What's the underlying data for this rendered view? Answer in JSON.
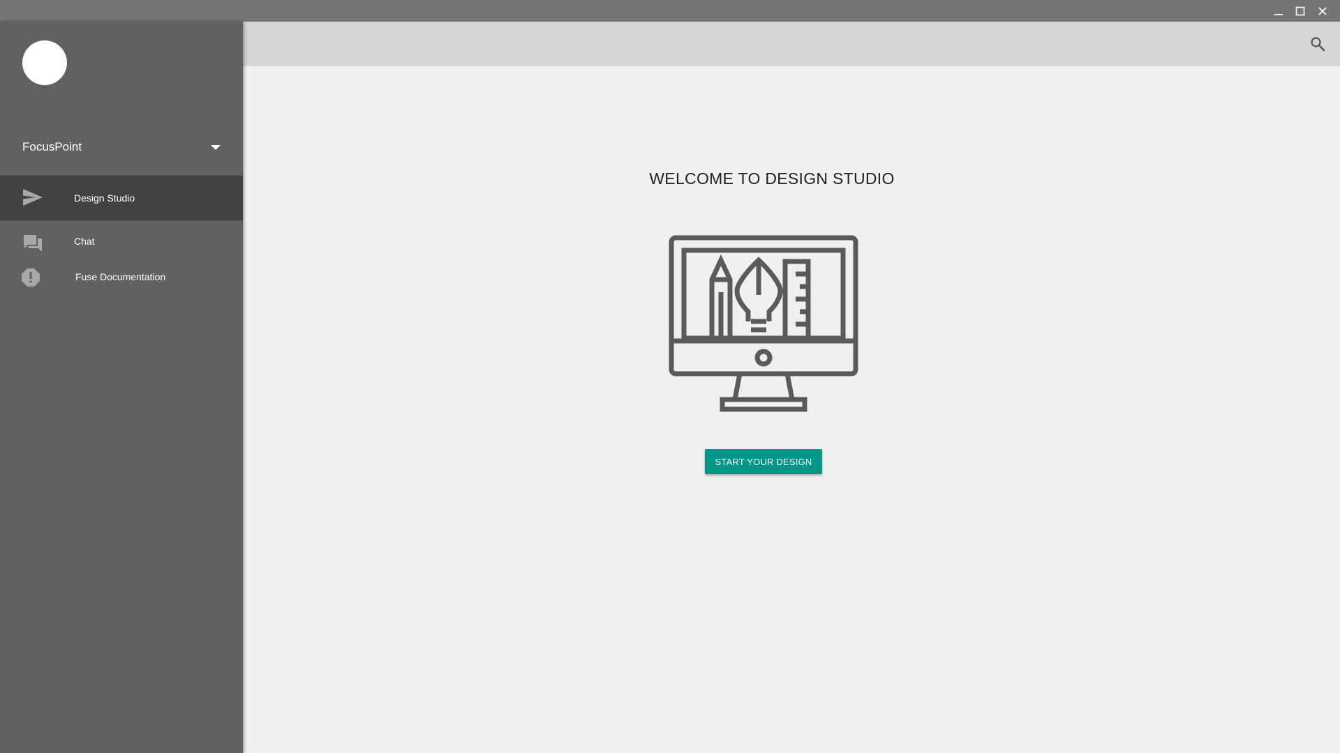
{
  "window": {
    "controls": [
      "minimize-icon",
      "maximize-icon",
      "close-icon"
    ]
  },
  "sidebar": {
    "account_name": "FocusPoint",
    "items": [
      {
        "label": "Design Studio",
        "icon": "send-icon",
        "active": true
      },
      {
        "label": "Chat",
        "icon": "chat-icon",
        "active": false
      },
      {
        "label": "Fuse Documentation",
        "icon": "alert-octagon-icon",
        "active": false
      }
    ]
  },
  "toolbar": {
    "search_icon": "search-icon"
  },
  "main": {
    "title": "WELCOME TO DESIGN STUDIO",
    "illustration_icon": "design-monitor-icon",
    "start_button": "START YOUR DESIGN"
  },
  "colors": {
    "titlebar": "#757575",
    "sidebar": "#616161",
    "sidebar_active": "#424242",
    "toolbar": "#d6d6d6",
    "content_bg": "#f0f0f0",
    "accent": "#009688",
    "icon_gray": "#5a5a5a"
  }
}
